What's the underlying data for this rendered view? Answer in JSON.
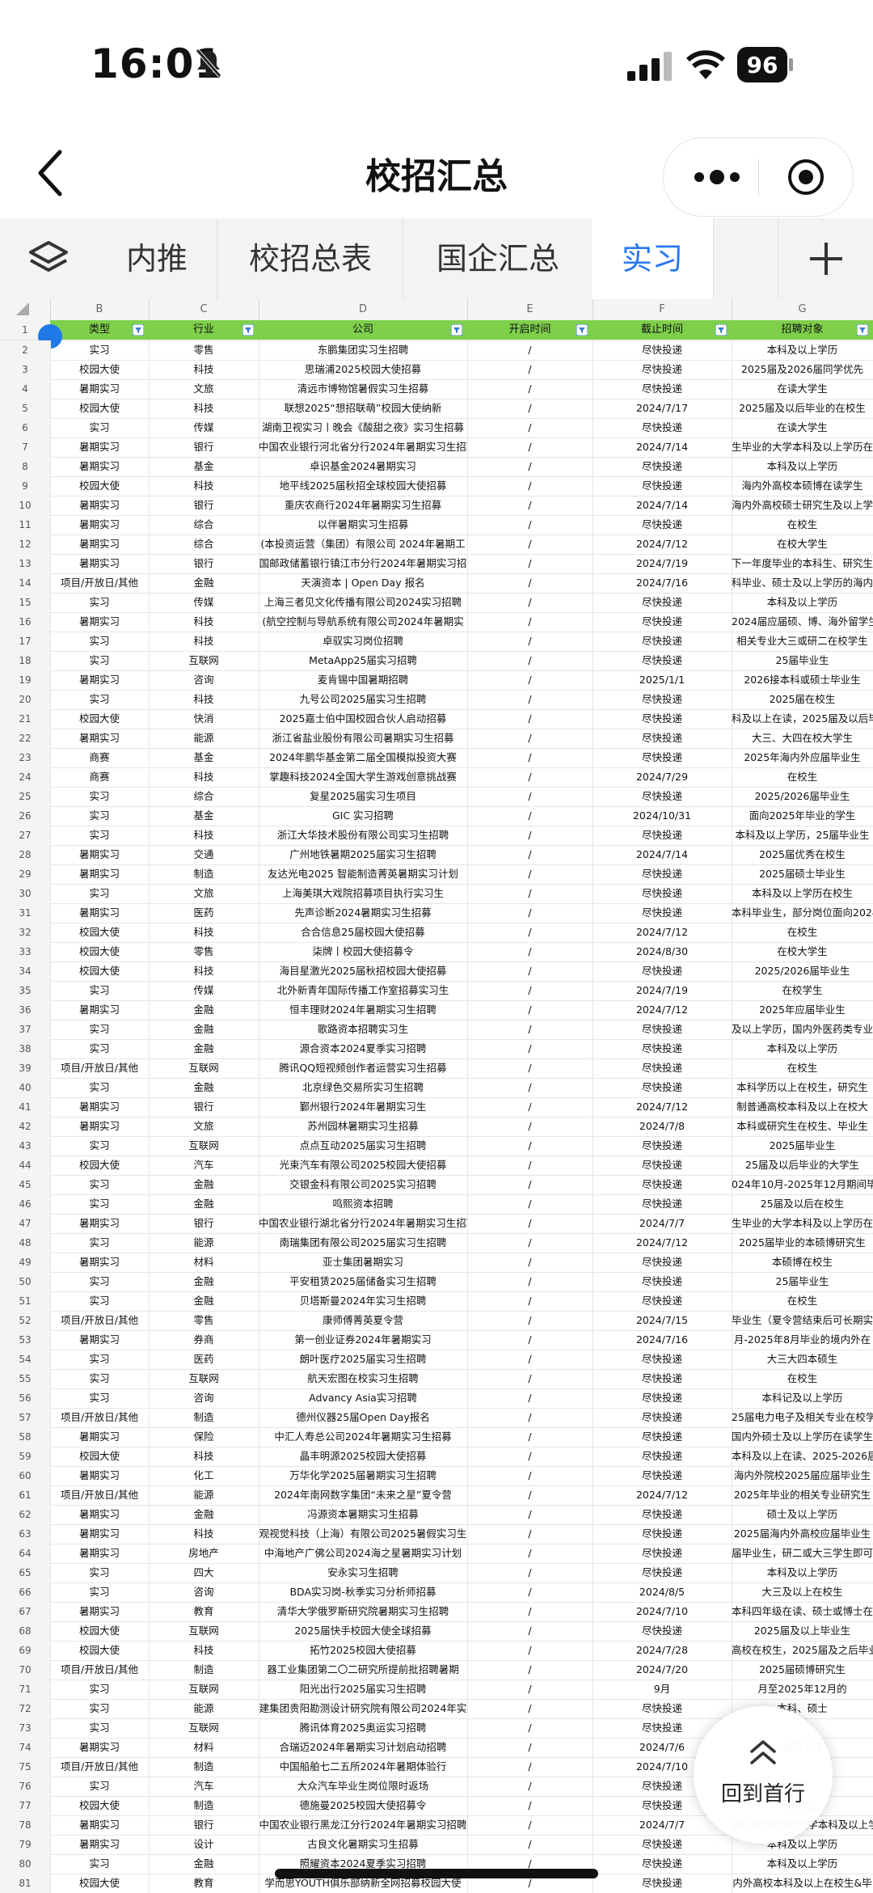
{
  "status": {
    "time": "16:01",
    "battery": "96"
  },
  "nav": {
    "title": "校招汇总"
  },
  "tabs": [
    {
      "label": "",
      "icon": "layers-icon"
    },
    {
      "label": "内推"
    },
    {
      "label": "校招总表"
    },
    {
      "label": "国企汇总"
    },
    {
      "label": "实习"
    },
    {
      "label": "+",
      "icon": "add-icon"
    }
  ],
  "sheet": {
    "col_letters": [
      "B",
      "C",
      "D",
      "E",
      "F",
      "G"
    ],
    "headers": [
      "类型",
      "行业",
      "公司",
      "开启时间",
      "截止时间",
      "招聘对象"
    ],
    "header_color": "#7ed04b",
    "rows": [
      [
        "2",
        "实习",
        "零售",
        "东鹏集团实习生招聘",
        "/",
        "尽快投递",
        "本科及以上学历"
      ],
      [
        "3",
        "校园大使",
        "科技",
        "思瑞浦2025校园大使招募",
        "/",
        "尽快投递",
        "2025届及2026届同学优先"
      ],
      [
        "4",
        "暑期实习",
        "文旅",
        "清远市博物馆暑假实习生招募",
        "/",
        "尽快投递",
        "在读大学生"
      ],
      [
        "5",
        "校园大使",
        "科技",
        "联想2025“想招联萌”校园大使纳新",
        "/",
        "2024/7/17",
        "2025届及以后毕业的在校生"
      ],
      [
        "6",
        "实习",
        "传媒",
        "湖南卫视实习丨晚会《酸甜之夜》实习生招募",
        "/",
        "尽快投递",
        "在读大学生"
      ],
      [
        "7",
        "暑期实习",
        "银行",
        "中国农业银行河北省分行2024年暑期实习生招聘",
        "/",
        "2024/7/14",
        "生毕业的大学本科及以上学历在"
      ],
      [
        "8",
        "暑期实习",
        "基金",
        "卓识基金2024暑期实习",
        "/",
        "尽快投递",
        "本科及以上学历"
      ],
      [
        "9",
        "校园大使",
        "科技",
        "地平线2025届秋招全球校园大使招募",
        "/",
        "尽快投递",
        "海内外高校本硕博在读学生"
      ],
      [
        "10",
        "暑期实习",
        "银行",
        "重庆农商行2024年暑期实习生招募",
        "/",
        "2024/7/14",
        "海内外高校硕士研究生及以上学"
      ],
      [
        "11",
        "暑期实习",
        "综合",
        "以伴暑期实习生招募",
        "/",
        "尽快投递",
        "在校生"
      ],
      [
        "12",
        "暑期实习",
        "综合",
        "(本投资运营（集团）有限公司 2024年暑期工",
        "/",
        "2024/7/12",
        "在校大学生"
      ],
      [
        "13",
        "暑期实习",
        "银行",
        "国邮政储蓄银行镇江市分行2024年暑期实习招",
        "/",
        "2024/7/19",
        "下一年度毕业的本科生、研究生"
      ],
      [
        "14",
        "项目/开放日/其他",
        "金融",
        "天演资本 | Open Day 报名",
        "/",
        "2024/7/16",
        "科毕业、硕士及以上学历的海内"
      ],
      [
        "15",
        "实习",
        "传媒",
        "上海三者见文化传播有限公司2024实习招聘",
        "/",
        "尽快投递",
        "本科及以上学历"
      ],
      [
        "16",
        "暑期实习",
        "科技",
        "(航空控制与导航系统有限公司2024年暑期实",
        "/",
        "尽快投递",
        "2024届应届硕、博、海外留学生"
      ],
      [
        "17",
        "实习",
        "科技",
        "卓驭实习岗位招聘",
        "/",
        "尽快投递",
        "相关专业大三或研二在校学生"
      ],
      [
        "18",
        "实习",
        "互联网",
        "MetaApp25届实习招聘",
        "/",
        "尽快投递",
        "25届毕业生"
      ],
      [
        "19",
        "暑期实习",
        "咨询",
        "麦肯锡中国暑期招聘",
        "/",
        "2025/1/1",
        "2026接本科或硕士毕业生"
      ],
      [
        "20",
        "实习",
        "科技",
        "九号公司2025届实习生招聘",
        "/",
        "尽快投递",
        "2025届在校生"
      ],
      [
        "21",
        "校园大使",
        "快消",
        "2025嘉士伯中国校园合伙人启动招募",
        "/",
        "尽快投递",
        "科及以上在读，2025届及以后毕"
      ],
      [
        "22",
        "暑期实习",
        "能源",
        "浙江省盐业股份有限公司暑期实习生招募",
        "/",
        "尽快投递",
        "大三、大四在校大学生"
      ],
      [
        "23",
        "商赛",
        "基金",
        "2024年鹏华基金第二届全国模拟投资大赛",
        "/",
        "尽快投递",
        "2025年海内外应届毕业生"
      ],
      [
        "24",
        "商赛",
        "科技",
        "掌趣科技2024全国大学生游戏创意挑战赛",
        "/",
        "2024/7/29",
        "在校生"
      ],
      [
        "25",
        "实习",
        "综合",
        "复星2025届实习生项目",
        "/",
        "尽快投递",
        "2025/2026届毕业生"
      ],
      [
        "26",
        "实习",
        "基金",
        "GIC 实习招聘",
        "/",
        "2024/10/31",
        "面向2025年毕业的学生"
      ],
      [
        "27",
        "实习",
        "科技",
        "浙江大华技术股份有限公司实习生招聘",
        "/",
        "尽快投递",
        "本科及以上学历，25届毕业生"
      ],
      [
        "28",
        "暑期实习",
        "交通",
        "广州地铁暑期2025届实习生招聘",
        "/",
        "2024/7/14",
        "2025届优秀在校生"
      ],
      [
        "29",
        "暑期实习",
        "制造",
        "友达光电2025 智能制造菁英暑期实习计划",
        "/",
        "尽快投递",
        "2025届硕士毕业生"
      ],
      [
        "30",
        "实习",
        "文旅",
        "上海美琪大戏院招募项目执行实习生",
        "/",
        "尽快投递",
        "本科及以上学历在校生"
      ],
      [
        "31",
        "暑期实习",
        "医药",
        "先声诊断2024暑期实习生招募",
        "/",
        "尽快投递",
        "本科毕业生，部分岗位面向2024届"
      ],
      [
        "32",
        "校园大使",
        "科技",
        "合合信息25届校园大使招募",
        "/",
        "2024/7/12",
        "在校生"
      ],
      [
        "33",
        "校园大使",
        "零售",
        "柒牌丨校园大使招募令",
        "/",
        "2024/8/30",
        "在校大学生"
      ],
      [
        "34",
        "校园大使",
        "科技",
        "海目星激光2025届秋招校园大使招募",
        "/",
        "尽快投递",
        "2025/2026届毕业生"
      ],
      [
        "35",
        "实习",
        "传媒",
        "北外新青年国际传播工作室招募实习生",
        "/",
        "2024/7/19",
        "在校学生"
      ],
      [
        "36",
        "暑期实习",
        "金融",
        "恒丰理财2024年暑期实习生招聘",
        "/",
        "2024/7/12",
        "2025年应届毕业生"
      ],
      [
        "37",
        "实习",
        "金融",
        "歌路资本招聘实习生",
        "/",
        "尽快投递",
        "及以上学历，国内外医药类专业"
      ],
      [
        "38",
        "实习",
        "金融",
        "源合资本2024夏季实习招聘",
        "/",
        "尽快投递",
        "本科及以上学历"
      ],
      [
        "39",
        "项目/开放日/其他",
        "互联网",
        "腾讯QQ短视频创作者运营实习生招募",
        "/",
        "尽快投递",
        "在校生"
      ],
      [
        "40",
        "实习",
        "金融",
        "北京绿色交易所实习生招聘",
        "/",
        "尽快投递",
        "本科学历以上在校生，研究生"
      ],
      [
        "41",
        "暑期实习",
        "银行",
        "鄞州银行2024年暑期实习生",
        "/",
        "2024/7/12",
        "制普通高校本科及以上在校大"
      ],
      [
        "42",
        "暑期实习",
        "文旅",
        "苏州园林暑期实习生招募",
        "/",
        "2024/7/8",
        "本科或研究生在校生、毕业生"
      ],
      [
        "43",
        "实习",
        "互联网",
        "点点互动2025届实习生招聘",
        "/",
        "尽快投递",
        "2025届毕业生"
      ],
      [
        "44",
        "校园大使",
        "汽车",
        "光束汽车有限公司2025校园大使招募",
        "/",
        "尽快投递",
        "25届及以后毕业的大学生"
      ],
      [
        "45",
        "实习",
        "金融",
        "交银金科有限公司2025实习招聘",
        "/",
        "尽快投递",
        "024年10月-2025年12月期间毕"
      ],
      [
        "46",
        "实习",
        "金融",
        "鸣熙资本招聘",
        "/",
        "尽快投递",
        "25届及以后在校生"
      ],
      [
        "47",
        "暑期实习",
        "银行",
        "中国农业银行湖北省分行2024年暑期实习生招聘",
        "/",
        "2024/7/7",
        "生毕业的大学本科及以上学历在"
      ],
      [
        "48",
        "实习",
        "能源",
        "南瑞集团有限公司2025届实习生招聘",
        "/",
        "2024/7/12",
        "2025届毕业的本硕博研究生"
      ],
      [
        "49",
        "暑期实习",
        "材料",
        "亚士集团暑期实习",
        "/",
        "尽快投递",
        "本硕博在校生"
      ],
      [
        "50",
        "实习",
        "金融",
        "平安租赁2025届储备实习生招聘",
        "/",
        "尽快投递",
        "25届毕业生"
      ],
      [
        "51",
        "实习",
        "金融",
        "贝塔斯曼2024年实习生招聘",
        "/",
        "尽快投递",
        "在校生"
      ],
      [
        "52",
        "项目/开放日/其他",
        "零售",
        "康师傅菁英夏令营",
        "/",
        "2024/7/15",
        "毕业生（夏令营结束后可长期实"
      ],
      [
        "53",
        "暑期实习",
        "券商",
        "第一创业证券2024年暑期实习",
        "/",
        "2024/7/16",
        "月-2025年8月毕业的境内外在"
      ],
      [
        "54",
        "实习",
        "医药",
        "朗叶医疗2025届实习生招聘",
        "/",
        "尽快投递",
        "大三大四本硕生"
      ],
      [
        "55",
        "实习",
        "互联网",
        "航天宏图在校实习生招聘",
        "/",
        "尽快投递",
        "在校生"
      ],
      [
        "56",
        "实习",
        "咨询",
        "Advancy Asia实习招聘",
        "/",
        "尽快投递",
        "本科记及以上学历"
      ],
      [
        "57",
        "项目/开放日/其他",
        "制造",
        "德州仪器25届Open Day报名",
        "/",
        "尽快投递",
        "25届电力电子及相关专业在校学"
      ],
      [
        "58",
        "暑期实习",
        "保险",
        "中汇人寿总公司2024年暑期实习生招募",
        "/",
        "尽快投递",
        "国内外硕士及以上学历在读学生"
      ],
      [
        "59",
        "校园大使",
        "科技",
        "晶丰明源2025校园大使招募",
        "/",
        "尽快投递",
        "本科及以上在读、2025-2026届"
      ],
      [
        "60",
        "暑期实习",
        "化工",
        "万华化学2025届暑期实习生招聘",
        "/",
        "尽快投递",
        "海内外院校2025届应届毕业生"
      ],
      [
        "61",
        "项目/开放日/其他",
        "能源",
        "2024年南网数字集团“未来之星”夏令营",
        "/",
        "2024/7/12",
        "2025年毕业的相关专业研究生"
      ],
      [
        "62",
        "暑期实习",
        "金融",
        "冯源资本暑期实习生招募",
        "/",
        "尽快投递",
        "硕士及以上学历"
      ],
      [
        "63",
        "暑期实习",
        "科技",
        "观视觉科技（上海）有限公司2025暑假实习生",
        "/",
        "尽快投递",
        "2025届海内外高校应届毕业生"
      ],
      [
        "64",
        "暑期实习",
        "房地产",
        "中海地产广佛公司2024海之星暑期实习计划",
        "/",
        "尽快投递",
        "届毕业生，研二或大三学生即可"
      ],
      [
        "65",
        "实习",
        "四大",
        "安永实习生招聘",
        "/",
        "尽快投递",
        "本科及以上学历"
      ],
      [
        "66",
        "实习",
        "咨询",
        "BDA实习岗-秋季实习分析师招募",
        "/",
        "2024/8/5",
        "大三及以上在校生"
      ],
      [
        "67",
        "暑期实习",
        "教育",
        "清华大学俄罗斯研究院暑期实习生招聘",
        "/",
        "2024/7/10",
        "本科四年级在读、硕士或博士在读"
      ],
      [
        "68",
        "校园大使",
        "互联网",
        "2025届快手校园大使全球招募",
        "/",
        "尽快投递",
        "2025届及以上毕业生"
      ],
      [
        "69",
        "校园大使",
        "科技",
        "拓竹2025校园大使招募",
        "/",
        "2024/7/28",
        "高校在校生，2025届及之后毕业"
      ],
      [
        "70",
        "项目/开放日/其他",
        "制造",
        "器工业集团第二〇二研究所提前批招聘暑期",
        "/",
        "2024/7/20",
        "2025届硕博研究生"
      ],
      [
        "71",
        "实习",
        "互联网",
        "阳光出行2025届实习生招聘",
        "/",
        "9月",
        "月至2025年12月的"
      ],
      [
        "72",
        "实习",
        "能源",
        "建集团贵阳勘测设计研究院有限公司2024年实",
        "/",
        "尽快投递",
        "本科、硕士"
      ],
      [
        "73",
        "实习",
        "互联网",
        "腾讯体育2025奥运实习招聘",
        "/",
        "尽快投递",
        ""
      ],
      [
        "74",
        "暑期实习",
        "材料",
        "合瑞迈2024年暑期实习计划启动招聘",
        "/",
        "2024/7/6",
        "或硕士研"
      ],
      [
        "75",
        "项目/开放日/其他",
        "制造",
        "中国船舶七二五所2024年暑期体验行",
        "/",
        "2024/7/10",
        ""
      ],
      [
        "76",
        "实习",
        "汽车",
        "大众汽车毕业生岗位限时返场",
        "/",
        "尽快投递",
        ""
      ],
      [
        "77",
        "校园大使",
        "制造",
        "德施曼2025校园大使招募令",
        "/",
        "尽快投递",
        "在校生"
      ],
      [
        "78",
        "暑期实习",
        "银行",
        "中国农业银行黑龙江分行2024年暑期实习招聘",
        "/",
        "2024/7/7",
        "2025年毕业的大学本科及以上学"
      ],
      [
        "79",
        "暑期实习",
        "设计",
        "古良文化暑期实习生招募",
        "/",
        "尽快投递",
        "本科及以上学历"
      ],
      [
        "80",
        "实习",
        "金融",
        "照耀资本2024夏季实习招聘",
        "/",
        "尽快投递",
        "本科及以上学历"
      ],
      [
        "81",
        "校园大使",
        "教育",
        "学而思YOUTH俱乐部纳新全网招募校园大使",
        "/",
        "尽快投递",
        "内外高校本科及以上在校生&毕"
      ]
    ]
  },
  "back_to_top": {
    "label": "回到首行"
  }
}
